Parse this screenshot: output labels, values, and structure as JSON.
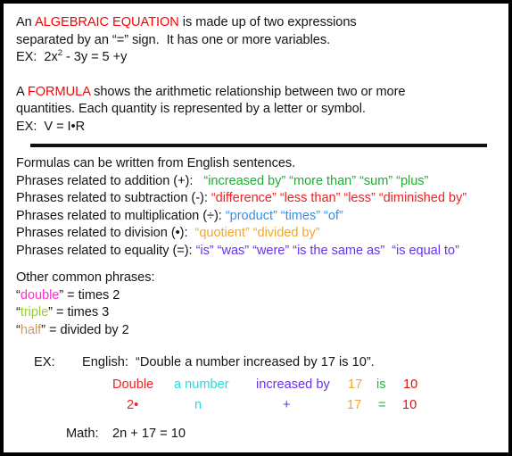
{
  "definitions": [
    {
      "id": "algebraic-equation",
      "lead": "An ",
      "keyword": "ALGEBRAIC EQUATION",
      "rest": " is made up of two expressions",
      "line2": "separated by an “=” sign.  It has one or more variables.",
      "example_label": "EX:",
      "example_pre": "  2x",
      "example_sup": "2",
      "example_post": " - 3y = 5 +y"
    },
    {
      "id": "formula",
      "lead": "A ",
      "keyword": "FORMULA",
      "rest": " shows the arithmetic relationship between two or more",
      "line2": "quantities. Each quantity is represented by a letter or symbol.",
      "example_label": "EX:",
      "example_pre": "  V = I•R",
      "example_sup": "",
      "example_post": ""
    }
  ],
  "phrases_section": {
    "intro": "Formulas can be written from English sentences.",
    "rows": [
      {
        "label": "Phrases related to addition (+):",
        "color_class": "c-add",
        "terms": [
          "“increased by”",
          "“more than”",
          "“sum”",
          "“plus”"
        ]
      },
      {
        "label": "Phrases related to subtraction (-):",
        "color_class": "c-sub",
        "terms": [
          "“difference”",
          "“less than”",
          "“less”",
          "“diminished by”"
        ]
      },
      {
        "label": "Phrases related to multiplication (÷):",
        "color_class": "c-mul",
        "terms": [
          "“product”",
          "“times”",
          "“of”"
        ]
      },
      {
        "label": "Phrases related to division (•):",
        "color_class": "c-div",
        "terms": [
          "“quotient”",
          "“divided by”"
        ]
      },
      {
        "label": "Phrases related to equality (=):",
        "color_class": "c-eq",
        "terms": [
          "“is”",
          "“was”",
          "“were”",
          "“is the same as”",
          "“is equal to”"
        ]
      }
    ]
  },
  "other_phrases": {
    "heading": "Other common phrases:",
    "items": [
      {
        "quoted": "double",
        "color_class": "c-double",
        "definition": " = times 2"
      },
      {
        "quoted": "triple",
        "color_class": "c-triple",
        "definition": " = times 3"
      },
      {
        "quoted": "half",
        "color_class": "c-half",
        "definition": " = divided by 2"
      }
    ]
  },
  "worked_example": {
    "ex_label": "EX:",
    "english_label": "English:",
    "english_sentence": "“Double a number increased by 17 is 10”.",
    "mapping": [
      {
        "english": "Double",
        "math": "2•",
        "color_class": "ex-c-double",
        "left_en": 108,
        "left_math": 124
      },
      {
        "english": "a number",
        "math": "n",
        "color_class": "ex-c-num",
        "left_en": 177,
        "left_math": 200
      },
      {
        "english": "increased by",
        "math": "+",
        "color_class": "ex-c-inc",
        "left_en": 269,
        "left_math": 299
      },
      {
        "english": "17",
        "math": "17",
        "color_class": "ex-c-17",
        "left_en": 372,
        "left_math": 371
      },
      {
        "english": "is",
        "math": "=",
        "color_class": "ex-c-is",
        "left_en": 404,
        "left_math": 406
      },
      {
        "english": "10",
        "math": "10",
        "color_class": "ex-c-10",
        "left_en": 434,
        "left_math": 433
      }
    ],
    "math_label": "Math:",
    "math_answer": "2n + 17 = 10"
  },
  "colors": {
    "keyword": "#ff0000",
    "addition": "#22aa33",
    "subtraction": "#ee2222",
    "multiplication": "#3a8ede",
    "division": "#f0a82e",
    "equality": "#6633ee",
    "double": "#ff33cc",
    "triple": "#9ccb38",
    "half": "#cc9966",
    "border": "#000000",
    "background": "#ffffff",
    "text": "#141414"
  }
}
